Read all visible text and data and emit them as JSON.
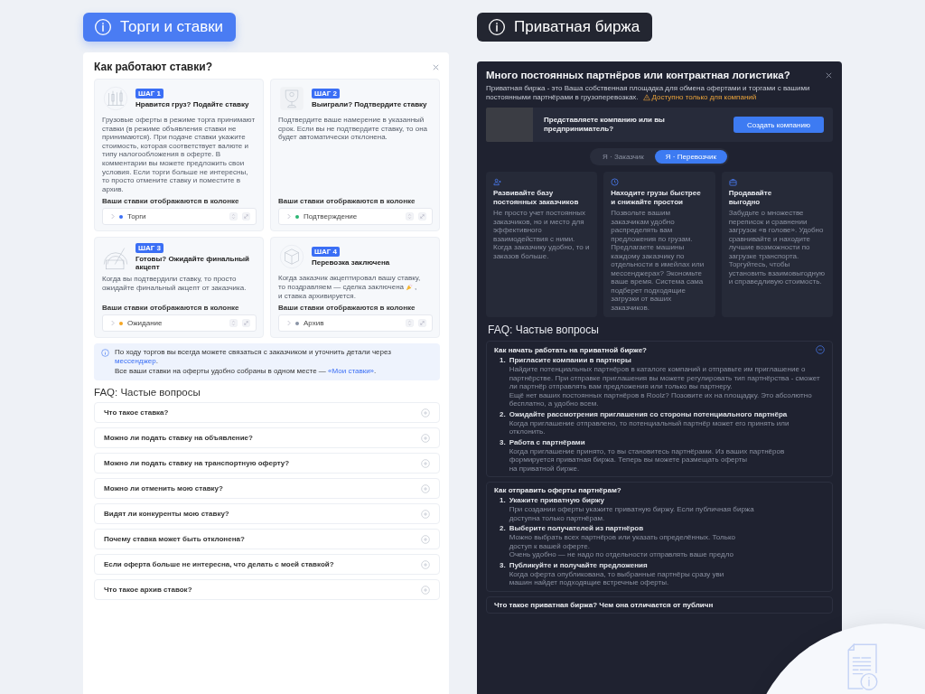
{
  "headers": [
    {
      "label": "Торги и ставки",
      "kind": "primary"
    },
    {
      "label": "Приватная биржа",
      "kind": "dark"
    }
  ],
  "bids_panel": {
    "title": "Как работают ставки?",
    "steps": [
      {
        "badge": "ШАГ 1",
        "title": "Нравится груз? Подайте ставку",
        "kind": "chart",
        "description": [
          [
            {
              "kind": "text",
              "text": "Грузовые оферты в режиме торга принимают ставки (в режиме объявления ставки не принимаются). При подаче ставки укажите стоимость, которая соответствует валюте и типу налогообложения в оферте. В комментарии вы можете предложить свои условия. Если торги больше не интересны, то просто отмените ставку и поместите в архив."
            }
          ]
        ],
        "caption": "Ваши ставки отображаются в колонке",
        "column": "Торги",
        "color": "#3b6ff5"
      },
      {
        "badge": "ШАГ 2",
        "title": "Выиграли? Подтвердите ставку",
        "kind": "trophy",
        "description": [
          [
            {
              "kind": "text",
              "text": "Подтвердите ваше намерение в указанный срок. Если вы не подтвердите ставку, то она будет автоматически отклонена."
            }
          ]
        ],
        "caption": "Ваши ставки отображаются в колонке",
        "column": "Подтверждение",
        "color": "#2bb673"
      },
      {
        "badge": "ШАГ 3",
        "title": "Готовы? Ожидайте финальный акцепт",
        "kind": "gauge",
        "description": [
          [
            {
              "kind": "text",
              "text": "Когда вы подтвердили ставку, то просто ожидайте финальный акцепт от заказчика."
            }
          ]
        ],
        "caption": "Ваши ставки отображаются в колонке",
        "column": "Ожидание",
        "color": "#f5a623"
      },
      {
        "badge": "ШАГ 4",
        "title": "Перевозка заключена",
        "kind": "box",
        "description": [
          [
            {
              "kind": "text",
              "text": "Когда заказчик акцептировал вашу ставку,"
            }
          ],
          [
            {
              "kind": "text",
              "text": "то поздравляем — сделка заключена"
            },
            {
              "kind": "emoji"
            },
            {
              "kind": "text",
              "text": ","
            }
          ],
          [
            {
              "kind": "text",
              "text": "и ставка архивируется."
            }
          ]
        ],
        "caption": "Ваши ставки отображаются в колонке",
        "column": "Архив",
        "color": "#8a94a6"
      }
    ],
    "info": [
      [
        {
          "kind": "text",
          "text": "По ходу торгов вы всегда можете связаться с заказчиком и уточнить детали через "
        },
        {
          "kind": "link",
          "text": "мессенджер"
        },
        {
          "kind": "text",
          "text": "."
        }
      ],
      [
        {
          "kind": "text",
          "text": "Все ваши ставки на оферты удобно собраны в одном месте — "
        },
        {
          "kind": "link",
          "text": "«Мои ставки»"
        },
        {
          "kind": "text",
          "text": "."
        }
      ]
    ],
    "faq_title": "FAQ: Частые вопросы",
    "faq": [
      {
        "question": "Что такое ставка?",
        "expanded": false
      },
      {
        "question": "Можно ли подать ставку на объявление?",
        "expanded": false
      },
      {
        "question": "Можно ли подать ставку на транспортную оферту?",
        "expanded": false
      },
      {
        "question": "Можно ли отменить мою ставку?",
        "expanded": false
      },
      {
        "question": "Видят ли конкуренты мою ставку?",
        "expanded": false
      },
      {
        "question": "Почему ставка может быть отклонена?",
        "expanded": false
      },
      {
        "question": "Если оферта больше не интересна, что делать с моей ставкой?",
        "expanded": false
      },
      {
        "question": "Что такое архив ставок?",
        "expanded": false
      }
    ]
  },
  "private_panel": {
    "title": "Много постоянных партнёров или контрактная логистика?",
    "description": [
      [
        {
          "kind": "text",
          "text": "Приватная биржа - это Ваша собственная площадка для обмена офертами и торгами с вашими"
        }
      ],
      [
        {
          "kind": "text",
          "text": "постоянными партнёрами в грузоперевозках."
        },
        {
          "kind": "warning"
        },
        {
          "kind": "note",
          "text": "Доступно только для компаний"
        }
      ]
    ],
    "company_question": "Представляете компанию или вы предприниматель?",
    "company_button": "Создать компанию",
    "roles": [
      {
        "label": "Я · Заказчик",
        "selected": false
      },
      {
        "label": "Я · Перевозчик",
        "selected": true
      }
    ],
    "features": [
      {
        "kind": "users",
        "title": "Развивайте базу\nпостоянных заказчиков",
        "description": "Не просто учет постоянных заказчиков, но и место для эффективного взаимодействия с ними. Когда заказчику удобно, то и заказов больше."
      },
      {
        "kind": "clock",
        "title": "Находите грузы быстрее\nи снижайте простои",
        "description": "Позвольте вашим заказчикам удобно распределять вам предложения по грузам. Предлагаете машины каждому заказчику по отдельности в имейлах или мессенджерах? Экономьте ваше время. Система сама подберет подходящие загрузки от ваших заказчиков."
      },
      {
        "kind": "briefcase",
        "title": "Продавайте\nвыгодно",
        "description": "Забудьте о множестве переписок и сравнении загрузок «в голове». Удобно сравнивайте и находите лучшие возможности по загрузке транспорта.\nТоргуйтесь, чтобы установить взаимовыгодную и справедливую стоимость."
      }
    ],
    "faq_title": "FAQ: Частые вопросы",
    "faq": [
      {
        "question": "Как начать работать на приватной бирже?",
        "expanded": true,
        "steps": [
          {
            "number": "1.",
            "title": "Пригласите компании в партнеры",
            "text": "Найдите потенциальных партнёров в каталоге компаний и отправьте им приглашение о партнёрстве. При отправке приглашения вы можете регулировать тип партнёрства - сможет ли партнёр отправлять вам предложения или только вы партнеру.\nЕщё нет ваших постоянных партнёров в Roolz? Позовите их на площадку. Это абсолютно бесплатно, а удобно всем."
          },
          {
            "number": "2.",
            "title": "Ожидайте рассмотрения приглашения со стороны потенциального партнёра",
            "text": "Когда приглашение отправлено, то потенциальный партнёр может его принять или отклонить."
          },
          {
            "number": "3.",
            "title": "Работа с партнёрами",
            "text": "Когда приглашение принято, то вы становитесь партнёрами. Из ваших партнёров формируется приватная биржа. Теперь вы можете размещать оферты\nна приватной бирже."
          }
        ]
      },
      {
        "question": "Как отправить оферты партнёрам?",
        "expanded": true,
        "steps": [
          {
            "number": "1.",
            "title": "Укажите приватную биржу",
            "text": "При создании оферты укажите приватную биржу. Если публичная биржа\nдоступна только партнёрам."
          },
          {
            "number": "2.",
            "title": "Выберите получателей из партнёров",
            "text": "Можно выбрать всех партнёров или указать определённых. Только\nдоступ к вашей оферте.\nОчень удобно — не надо по отдельности отправлять ваше предло"
          },
          {
            "number": "3.",
            "title": "Публикуйте и получайте предложения",
            "text": "Когда оферта опубликована, то выбранные партнёры сразу уви\nмашин найдет подходящие встречные оферты."
          }
        ]
      },
      {
        "question": "Что такое приватная биржа? Чем она отличается от публичн",
        "expanded": false
      }
    ]
  }
}
